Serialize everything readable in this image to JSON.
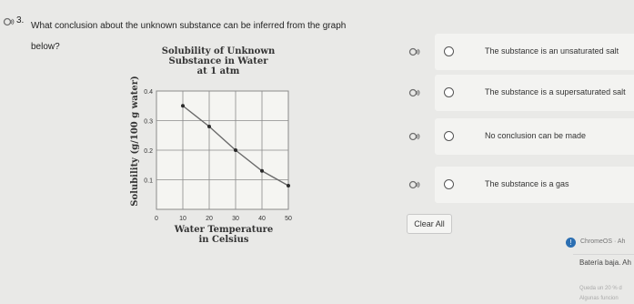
{
  "question": {
    "number": "3.",
    "text": "What conclusion about the unknown substance can be inferred from the graph below?"
  },
  "options": [
    {
      "label": "The substance is an unsaturated salt"
    },
    {
      "label": "The substance is a supersaturated salt"
    },
    {
      "label": "No conclusion can be made"
    },
    {
      "label": "The substance is a gas"
    }
  ],
  "clear_label": "Clear All",
  "notification": {
    "source": "ChromeOS · Ah",
    "title": "Batería baja. Ah",
    "line1": "Queda un 20 % d",
    "line2": "Algunas funcion"
  },
  "icons": [
    "speaker-icon",
    "radio-icon",
    "info-icon"
  ],
  "colors": {
    "line": "#6a6a6a",
    "point": "#2a2a2a",
    "grid": "#8a8a8a",
    "plot_bg": "#f5f5f2"
  },
  "chart_data": {
    "type": "line",
    "title_lines": [
      "Solubility of Unknown",
      "Substance in Water",
      "at 1 atm"
    ],
    "xlabel_lines": [
      "Water Temperature",
      "in Celsius"
    ],
    "ylabel": "Solubility (g/100 g water)",
    "x": [
      10,
      20,
      30,
      40,
      50
    ],
    "y": [
      0.35,
      0.28,
      0.2,
      0.13,
      0.08
    ],
    "xlim": [
      0,
      50
    ],
    "ylim": [
      0,
      0.4
    ],
    "xticks": [
      0,
      10,
      20,
      30,
      40,
      50
    ],
    "xtick_labels": [
      "0",
      "10",
      "20",
      "30",
      "40",
      "50"
    ],
    "yticks": [
      0.1,
      0.2,
      0.3,
      0.4
    ],
    "ytick_labels": [
      "0.1",
      "0.2",
      "0.3",
      "0.4"
    ],
    "grid": true
  }
}
